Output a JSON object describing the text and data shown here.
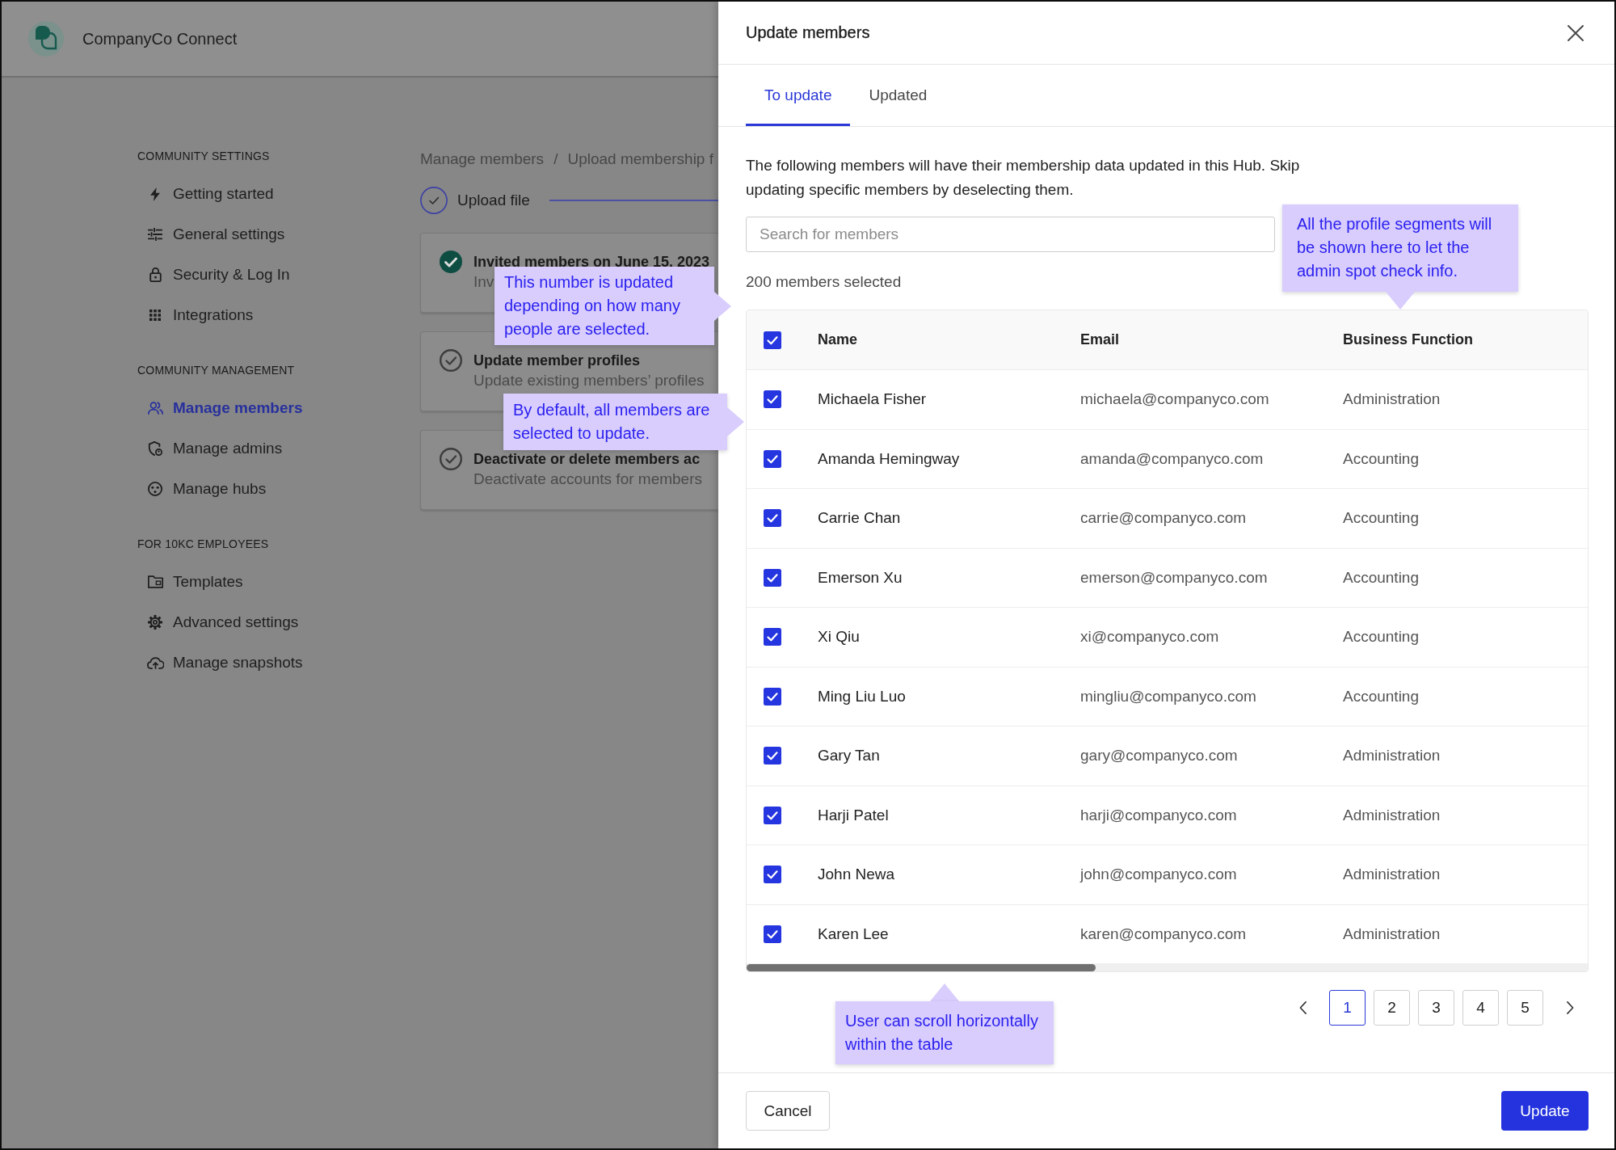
{
  "app": {
    "title": "CompanyCo Connect"
  },
  "sidebar": {
    "sections": [
      {
        "heading": "COMMUNITY SETTINGS",
        "items": [
          {
            "label": "Getting started",
            "selected": false
          },
          {
            "label": "General settings",
            "selected": false
          },
          {
            "label": "Security & Log In",
            "selected": false
          },
          {
            "label": "Integrations",
            "selected": false
          }
        ]
      },
      {
        "heading": "COMMUNITY MANAGEMENT",
        "items": [
          {
            "label": "Manage members",
            "selected": true
          },
          {
            "label": "Manage admins",
            "selected": false
          },
          {
            "label": "Manage hubs",
            "selected": false
          }
        ]
      },
      {
        "heading": "FOR 10KC EMPLOYEES",
        "items": [
          {
            "label": "Templates",
            "selected": false
          },
          {
            "label": "Advanced settings",
            "selected": false
          },
          {
            "label": "Manage snapshots",
            "selected": false
          }
        ]
      }
    ]
  },
  "main": {
    "breadcrumb": {
      "items": [
        "Manage members",
        "Upload membership f"
      ],
      "separator": "/"
    },
    "step": {
      "label": "Upload file"
    },
    "cards": [
      {
        "title": "Invited members on June 15, 2023",
        "subtitle": "Inv",
        "completed": true
      },
      {
        "title": "Update member profiles",
        "subtitle": "Update existing members’ profiles",
        "completed": false
      },
      {
        "title": "Deactivate or delete members ac",
        "subtitle": "Deactivate accounts for members",
        "completed": false
      }
    ]
  },
  "panel": {
    "title": "Update members",
    "tabs": [
      {
        "label": "To update",
        "selected": true
      },
      {
        "label": "Updated",
        "selected": false
      }
    ],
    "description": "The following members will have their membership data updated in this Hub. Skip updating specific members by deselecting them.",
    "search": {
      "placeholder": "Search for members"
    },
    "selection_count": "200 members selected",
    "table": {
      "all_checked": true,
      "columns": [
        "Name",
        "Email",
        "Business Function"
      ],
      "rows": [
        {
          "checked": true,
          "cells": [
            "Michaela Fisher",
            "michaela@companyco.com",
            "Administration"
          ]
        },
        {
          "checked": true,
          "cells": [
            "Amanda Hemingway",
            "amanda@companyco.com",
            "Accounting"
          ]
        },
        {
          "checked": true,
          "cells": [
            "Carrie Chan",
            "carrie@companyco.com",
            "Accounting"
          ]
        },
        {
          "checked": true,
          "cells": [
            "Emerson Xu",
            "emerson@companyco.com",
            "Accounting"
          ]
        },
        {
          "checked": true,
          "cells": [
            "Xi Qiu",
            "xi@companyco.com",
            "Accounting"
          ]
        },
        {
          "checked": true,
          "cells": [
            "Ming Liu Luo",
            "mingliu@companyco.com",
            "Accounting"
          ]
        },
        {
          "checked": true,
          "cells": [
            "Gary Tan",
            "gary@companyco.com",
            "Administration"
          ]
        },
        {
          "checked": true,
          "cells": [
            "Harji Patel",
            "harji@companyco.com",
            "Administration"
          ]
        },
        {
          "checked": true,
          "cells": [
            "John Newa",
            "john@companyco.com",
            "Administration"
          ]
        },
        {
          "checked": true,
          "cells": [
            "Karen Lee",
            "karen@companyco.com",
            "Administration"
          ]
        }
      ]
    },
    "pagination": {
      "pages": [
        {
          "label": "1",
          "selected": true
        },
        {
          "label": "2",
          "selected": false
        },
        {
          "label": "3",
          "selected": false
        },
        {
          "label": "4",
          "selected": false
        },
        {
          "label": "5",
          "selected": false
        }
      ]
    },
    "buttons": [
      {
        "label": "Cancel",
        "kind": "secondary"
      },
      {
        "label": "Update",
        "kind": "primary"
      }
    ]
  },
  "annotations": [
    {
      "text": "This number is updated depending on how many people are selected.",
      "kind": "right"
    },
    {
      "text": "By default, all members are selected to update.",
      "kind": "right"
    },
    {
      "text": "All the profile segments will be shown here to let the admin spot check info.",
      "kind": "down"
    },
    {
      "text": "User can scroll horizontally within the table",
      "kind": "up"
    }
  ]
}
